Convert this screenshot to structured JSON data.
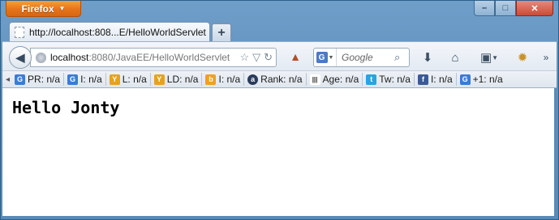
{
  "browser": {
    "menu_button_label": "Firefox",
    "window_controls": {
      "minimize": "–",
      "maximize": "□",
      "close": "✕"
    }
  },
  "tabs": [
    {
      "title": "http://localhost:808...E/HelloWorldServlet",
      "active": true
    }
  ],
  "new_tab_label": "+",
  "address_bar": {
    "host": "localhost",
    "path": ":8080/JavaEE/HelloWorldServlet"
  },
  "search_bar": {
    "engine_icon": "G",
    "placeholder": "Google"
  },
  "toolbar_icons": [
    "download-icon",
    "home-icon",
    "bookmarks-icon",
    "addon-icon"
  ],
  "addon_bar": [
    {
      "icon": "G",
      "color": "#3b7bd8",
      "label": "PR: n/a"
    },
    {
      "icon": "G",
      "color": "#3b7bd8",
      "label": "I: n/a"
    },
    {
      "icon": "Y",
      "color": "#e8a21a",
      "label": "L: n/a"
    },
    {
      "icon": "Y",
      "color": "#e8a21a",
      "label": "LD: n/a"
    },
    {
      "icon": "b",
      "color": "#f0a020",
      "label": "I: n/a"
    },
    {
      "icon": "a",
      "color": "#2a3a5a",
      "label": "Rank: n/a"
    },
    {
      "icon": "|||",
      "color": "#222222",
      "label": "Age: n/a"
    },
    {
      "icon": "t",
      "color": "#2aa3e0",
      "label": "Tw: n/a"
    },
    {
      "icon": "f",
      "color": "#3b5998",
      "label": "I: n/a"
    },
    {
      "icon": "G",
      "color": "#3b7bd8",
      "label": "+1: n/a"
    }
  ],
  "page": {
    "heading": "Hello Jonty"
  }
}
